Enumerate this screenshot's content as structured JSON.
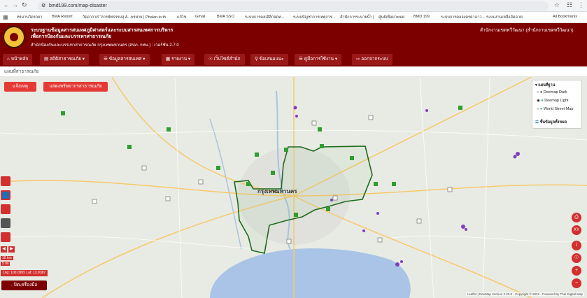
{
  "browser": {
    "url": "bmd199.com/map-disaster",
    "all_bookmarks": "All Bookmarks",
    "bookmarks": [
      "ทรมานวัดรถยา",
      "BMA Report",
      "วัดอากาศ \"ลารพัทธรรมสุ A...",
      "พรหาย | Phalan.io.th",
      "แก้ไข",
      "Gmail",
      "BMA SSO",
      "ระบบการคลเอิลิกจดท...",
      "ระบบบัญชาการเหตุการ...",
      "สำนักการระบายน้ำ |",
      "ศูนย์เพื่อมาฆนย",
      "BMD 199",
      "ระบบการคลองครคาอาว...",
      "ระบบงานเหลือจัดฉาต"
    ]
  },
  "header": {
    "title_line1": "ระบบฐานข้อมูลสารสนเทศภูมิศาสตร์และระบบสารสนเทศการบริหาร",
    "title_line2": "เพื่อการป้องกันและบรรเทาสาธารณภัย",
    "subtitle": "สำนักป้องกันและบรรเทาสาธารณภัย กรุงเทพมหานคร (สปภ. กทม.) : เวอร์ชั่น 2.7.0",
    "org": "สำนักงานเขตทวีวัฒนา (สำนักงานเขตทวีวัฒนา)"
  },
  "nav": [
    {
      "label": "หน้าหลัก",
      "icon": "home-icon"
    },
    {
      "label": "สถิติสาธารณภัย",
      "icon": "chart-icon"
    },
    {
      "label": "ข้อมูลสารสนเทศ",
      "icon": "list-icon"
    },
    {
      "label": "รายงาน",
      "icon": "report-icon"
    },
    {
      "label": "เว็บไซต์สำนัก",
      "icon": "globe-icon"
    },
    {
      "label": "ข้อเสนอแนะ",
      "icon": "search-icon"
    },
    {
      "label": "คู่มือการใช้งาน",
      "icon": "book-icon"
    },
    {
      "label": "ออกจากระบบ",
      "icon": "logout-icon"
    }
  ],
  "breadcrumb": "แผนที่สาธารณภัย",
  "map": {
    "btn_event": "แจ้งเหตุ",
    "btn_resource": "แสดงทรัพยากรสาธารณภัย",
    "layers_title": "แผนที่ฐาน",
    "layers": [
      {
        "label": "Deemap Dark",
        "checked": false
      },
      {
        "label": "Deemap Light",
        "checked": true
      },
      {
        "label": "World Street Map",
        "checked": false
      }
    ],
    "layers_data": "ชั้นข้อมูลทั้งหมด",
    "city_label": "กรุงเทพมหานคร",
    "scale_km": "10 km",
    "scale_mi": "5 mi",
    "coords": "Lng: 100.0955 Lat: 13.9387",
    "close_tools": "- ปิดเครื่องมือ",
    "attribution": "Leaflet | DeeMap Version 2.20.0 - Copyright © 2022 - Powered By Thai Digital Map"
  },
  "colors": {
    "header": "#7c0000",
    "accent": "#e53935",
    "boundary": "#1e6b1e",
    "sea": "#a9c4e6"
  }
}
